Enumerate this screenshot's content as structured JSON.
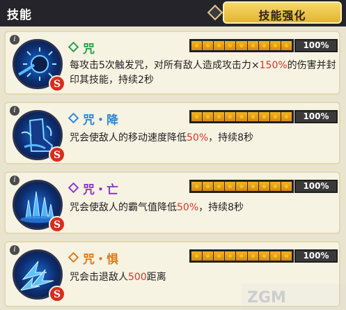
{
  "header": {
    "title": "技能",
    "tab_label": "技能强化"
  },
  "colors": {
    "green": "#2aa14a",
    "blue": "#2f88d8",
    "purple": "#8a3ad0",
    "orange": "#e07b19",
    "highlight": "#d2362b"
  },
  "skills": [
    {
      "name": "咒",
      "level_percent": 100,
      "percent_label": "100%",
      "desc_parts": [
        "每攻击5次触发咒，对所有敌人造成攻击力×",
        "150%",
        "的伤害并封印其技能，持续2秒"
      ],
      "icon": "dark-orb-icon"
    },
    {
      "name": "咒・降",
      "level_percent": 100,
      "percent_label": "100%",
      "desc_parts": [
        "咒会使敌人的移动速度降低",
        "50%",
        "，持续8秒"
      ],
      "icon": "slow-boot-icon"
    },
    {
      "name": "咒・亡",
      "level_percent": 100,
      "percent_label": "100%",
      "desc_parts": [
        "咒会使敌人的霸气值降低",
        "50%",
        "，持续8秒"
      ],
      "icon": "spike-burst-icon"
    },
    {
      "name": "咒・惧",
      "level_percent": 100,
      "percent_label": "100%",
      "desc_parts": [
        "咒会击退敌人",
        "500",
        "距离"
      ],
      "icon": "knockback-arrows-icon"
    }
  ],
  "badge_letter": "S",
  "info_glyph": "i",
  "watermark": "ZGM"
}
